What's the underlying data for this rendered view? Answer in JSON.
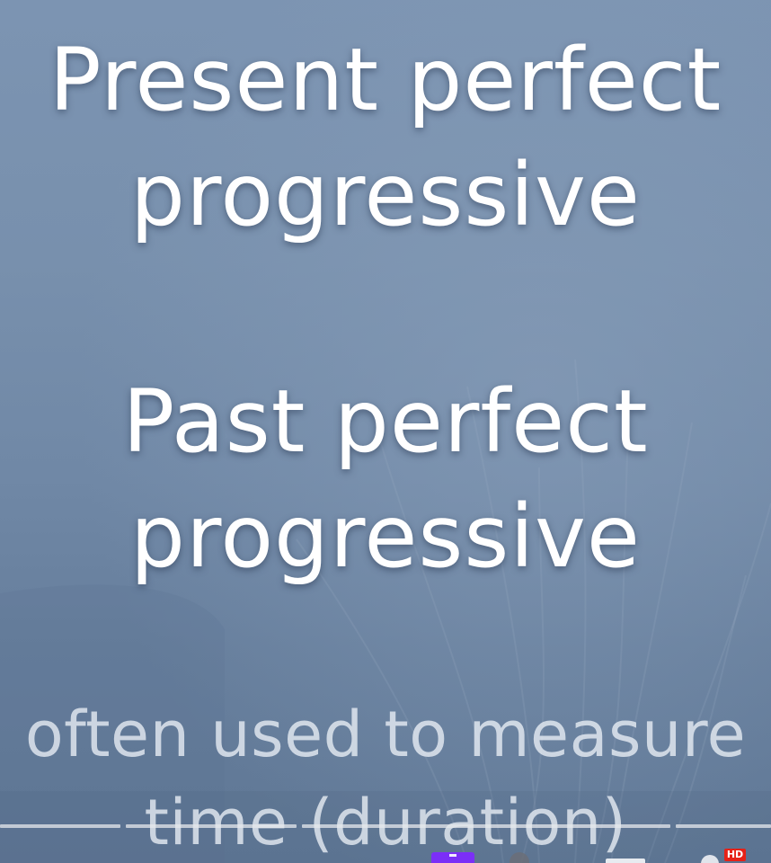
{
  "slide": {
    "heading_1": [
      "Present perfect",
      "progressive"
    ],
    "heading_2": [
      "Past perfect",
      "progressive"
    ],
    "caption": [
      "often used to measure",
      "time (duration)"
    ]
  },
  "player": {
    "hd_badge": "HD",
    "progress_fraction": 0.16,
    "colors": {
      "accent_purple": "#7b2ff7",
      "hd_red": "#e62117"
    },
    "icons": [
      "captions-icon",
      "autoplay-toggle-icon",
      "subtitles-icon",
      "settings-gear-icon"
    ]
  }
}
